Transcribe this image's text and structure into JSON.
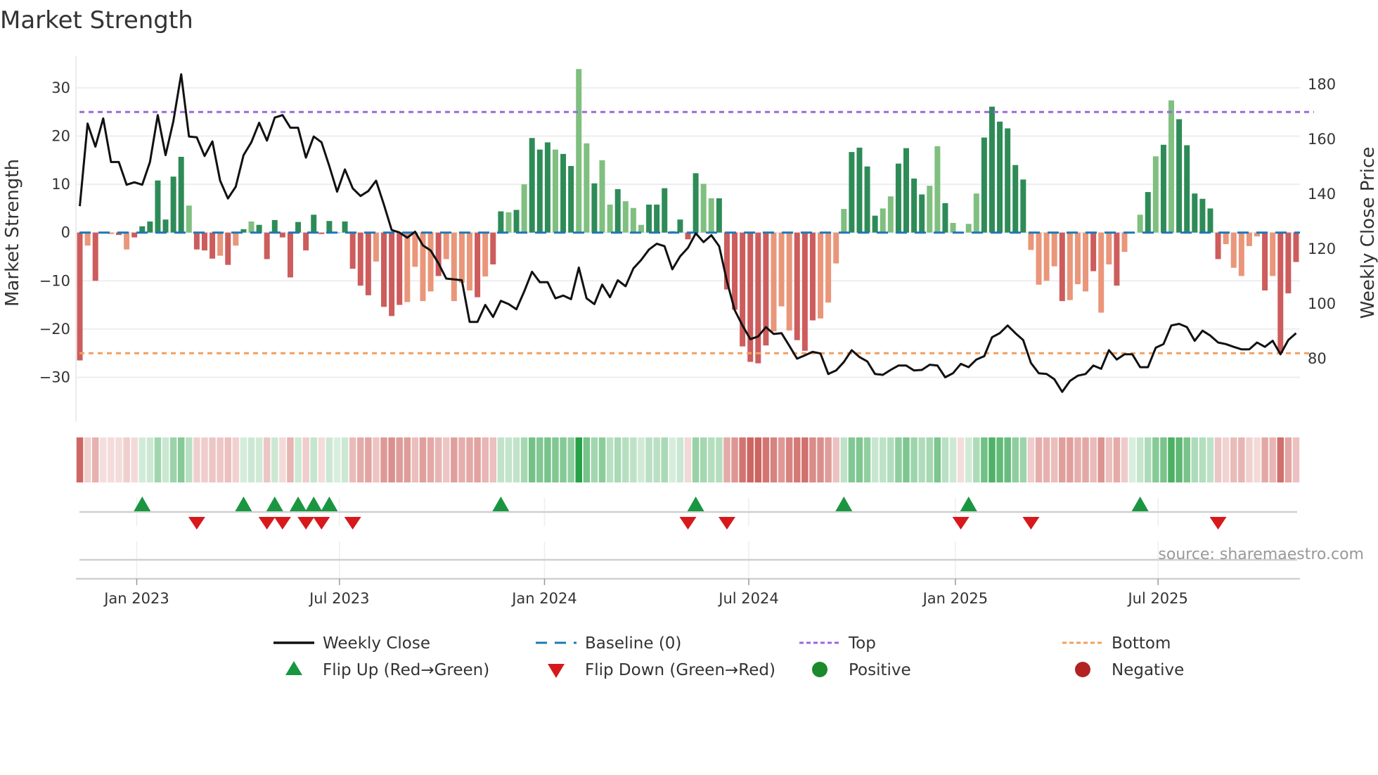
{
  "chart_data": {
    "type": "bar",
    "title": "Market Strength",
    "ylabel": "Market Strength",
    "y2label": "Weekly Close Price",
    "ylim": [
      -37.5,
      36
    ],
    "y2lim": [
      68,
      186
    ],
    "yticks": [
      30,
      20,
      10,
      0,
      -10,
      -20,
      -30
    ],
    "y2ticks": [
      180,
      160,
      140,
      120,
      100,
      80
    ],
    "xticks": [
      "Jan 2023",
      "Jul 2023",
      "Jan 2024",
      "Jul 2024",
      "Jan 2025",
      "Jul 2025"
    ],
    "xtick_week_index": [
      7.3,
      33.3,
      59.6,
      85.8,
      112.3,
      138.3
    ],
    "top_level": 25,
    "bottom_level": -25,
    "baseline": 0,
    "grid": true,
    "legend_position": "bottom-center",
    "colors": {
      "pos_dark": "#2e8b57",
      "pos_light": "#7fbf7f",
      "neg_dark": "#cd5c5c",
      "neg_light": "#e9967a",
      "price": "#111111",
      "baseline": "#1f77b4",
      "top": "#a066dd",
      "bottom": "#f0a060",
      "flip_up": "#1a9641",
      "flip_down": "#d7191c",
      "positive": "#1a8a2a",
      "negative": "#b22222"
    },
    "strength": [
      -26.5,
      -2.7,
      -10,
      -0.2,
      -0.3,
      -0.5,
      -3.5,
      -1,
      1.3,
      2.3,
      10.8,
      2.7,
      11.6,
      15.7,
      5.6,
      -3.5,
      -3.7,
      -5.4,
      -4.8,
      -6.7,
      -2.7,
      0.7,
      2.3,
      1.6,
      -5.5,
      2.6,
      -1,
      -9.3,
      2.2,
      -3.7,
      3.7,
      -0.3,
      2.4,
      0,
      2.3,
      -7.5,
      -11,
      -13,
      -6,
      -15.4,
      -17.3,
      -15,
      -14.4,
      -7.1,
      -14.2,
      -12.2,
      -9,
      -5.5,
      -14.2,
      -10.4,
      -12,
      -13.4,
      -9.1,
      -6.6,
      4.4,
      4.2,
      4.7,
      10,
      19.6,
      17.2,
      18.7,
      17.2,
      16.3,
      13.8,
      33.9,
      18.5,
      10.2,
      15,
      5.8,
      9,
      6.5,
      5.1,
      1.6,
      5.8,
      5.8,
      9.2,
      0.3,
      2.7,
      -1.4,
      12.3,
      10.1,
      7.1,
      7.1,
      -11.8,
      -16,
      -23.6,
      -26.8,
      -27.1,
      -23.4,
      -20.5,
      -15.3,
      -20.3,
      -22.3,
      -24.5,
      -18.2,
      -17.8,
      -14.5,
      -6.4,
      4.9,
      16.7,
      17.6,
      13.7,
      3.5,
      5,
      7.5,
      14.3,
      17.5,
      11.2,
      7.9,
      9.7,
      17.9,
      6.1,
      2,
      -0.1,
      1.8,
      8.1,
      19.7,
      26.1,
      23,
      21.6,
      14,
      11,
      -3.6,
      -10.8,
      -10,
      -7,
      -14.2,
      -14,
      -10.7,
      -12.2,
      -8,
      -16.6,
      -6.6,
      -11,
      -4,
      0,
      3.7,
      8.4,
      15.8,
      18.2,
      27.4,
      23.5,
      18.1,
      8.1,
      7,
      5,
      -5.5,
      -2.4,
      -7.3,
      -9,
      -2.8,
      -0.8,
      -12,
      -9,
      -25,
      -12.6,
      -6.1
    ],
    "shade": "dlddldldddddddldddldldldddddddddddddddldddlllldlllldlddldldddlddlldlldllldddldddlldddddddllldddllllddddllddddlldldllddddddlllldllldlldldldldlddddddllllldldddlldldlll",
    "weekly_close": [
      135.6,
      165.7,
      157.3,
      167.6,
      151.7,
      151.7,
      143.4,
      144.3,
      143.4,
      151.7,
      168.8,
      154.2,
      166.6,
      183.7,
      161,
      160.7,
      153.9,
      159.2,
      144.9,
      138.4,
      142.7,
      154.2,
      158.9,
      166,
      159.5,
      167.9,
      168.8,
      164.2,
      164.2,
      153.3,
      161,
      158.9,
      150.2,
      140.9,
      149,
      142.1,
      139.3,
      141.1,
      144.9,
      136.2,
      126.9,
      126,
      124.1,
      126.3,
      121.3,
      119.4,
      114.8,
      109.2,
      108.9,
      108.6,
      93.4,
      93.4,
      99.6,
      95.2,
      101.1,
      99.9,
      98,
      104.5,
      111.7,
      107.9,
      107.9,
      102,
      103,
      101.7,
      113.2,
      102,
      99.9,
      107,
      102.4,
      108.6,
      106.4,
      112.9,
      116,
      119.8,
      121.9,
      121,
      112.6,
      117.3,
      120.4,
      125.7,
      122.5,
      125,
      121,
      108.3,
      97.7,
      92.1,
      87.1,
      88.1,
      91.5,
      89,
      89.3,
      84.7,
      80,
      81.2,
      82.5,
      81.9,
      74.4,
      75.7,
      78.8,
      83.1,
      80.6,
      79,
      74.4,
      74.1,
      75.9,
      77.5,
      77.5,
      75.7,
      75.9,
      77.8,
      77.5,
      73.2,
      74.7,
      78.1,
      76.9,
      79.7,
      80.9,
      87.8,
      89.3,
      92.1,
      89.3,
      86.8,
      78.4,
      74.7,
      74.4,
      72.5,
      67.9,
      71.9,
      73.8,
      74.4,
      77.5,
      76.3,
      83.1,
      79.7,
      81.6,
      81.6,
      76.9,
      76.9,
      84,
      85.3,
      92.1,
      92.7,
      91.5,
      86.5,
      90.2,
      88.4,
      85.9,
      85.3,
      84.3,
      83.4,
      83.4,
      85.9,
      84.3,
      86.5,
      81.6,
      86.8,
      89.3
    ],
    "flip_up_week_index": [
      8,
      21,
      25,
      28,
      30,
      32,
      54,
      79,
      98,
      114,
      136
    ],
    "flip_down_week_index": [
      15,
      24,
      26,
      29,
      31,
      35,
      78,
      83,
      113,
      122,
      146
    ],
    "legend": [
      {
        "label": "Weekly Close",
        "kind": "line"
      },
      {
        "label": "Baseline (0)",
        "kind": "dash"
      },
      {
        "label": "Top",
        "kind": "dot-purple"
      },
      {
        "label": "Bottom",
        "kind": "dot-orange"
      },
      {
        "label": "Flip Up (Red→Green)",
        "kind": "tri-up"
      },
      {
        "label": "Flip Down (Green→Red)",
        "kind": "tri-down"
      },
      {
        "label": "Positive",
        "kind": "circle-green"
      },
      {
        "label": "Negative",
        "kind": "circle-red"
      }
    ],
    "source": "source: sharemaestro.com"
  }
}
